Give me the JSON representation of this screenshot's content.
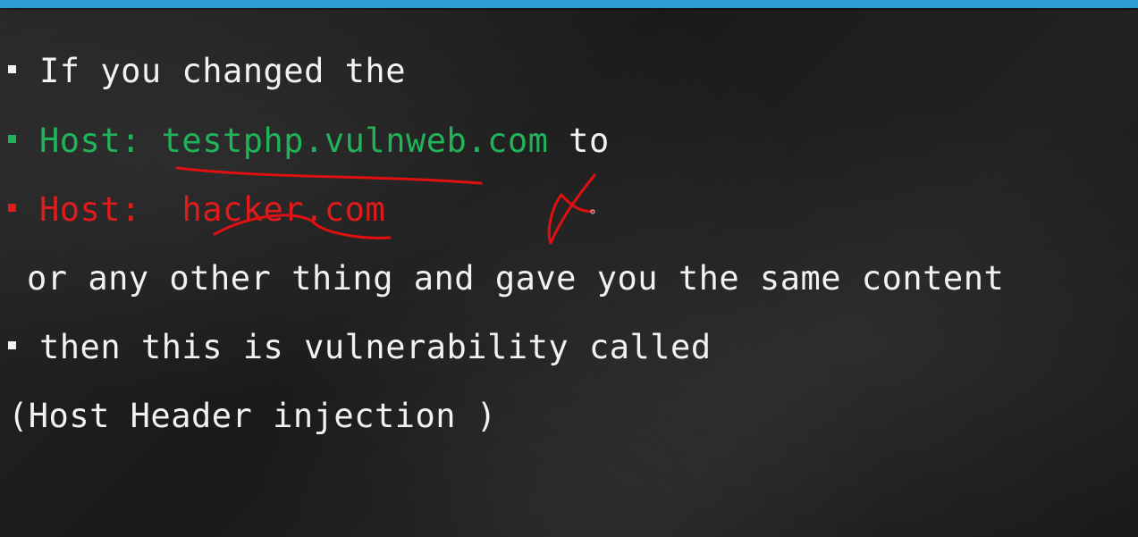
{
  "colors": {
    "accent_bar": "#2e9fd6",
    "green_text": "#20b35a",
    "red_text": "#e01b1b",
    "white_text": "#f2f2f2",
    "annotation_ink": "#e01010"
  },
  "slide": {
    "line1": {
      "text": "If you changed the"
    },
    "line2": {
      "prefix": "Host: ",
      "host": "testphp.vulnweb.com",
      "suffix": " to"
    },
    "line3": {
      "prefix": "Host:  ",
      "host": "hacker.com"
    },
    "line4": {
      "text": "or any other thing and gave you the same content"
    },
    "line5": {
      "text": "then this is vulnerability called"
    },
    "line6": {
      "text": "(Host Header injection )"
    }
  }
}
